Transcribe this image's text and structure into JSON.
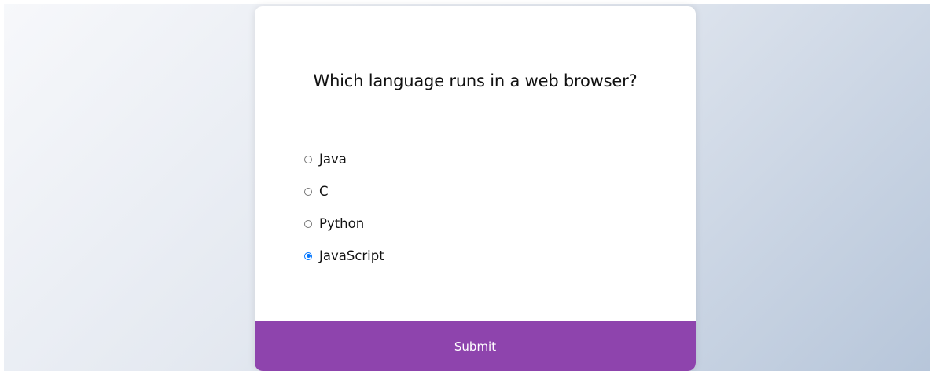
{
  "quiz": {
    "question": "Which language runs in a web browser?",
    "answers": [
      {
        "label": "Java",
        "selected": false
      },
      {
        "label": "C",
        "selected": false
      },
      {
        "label": "Python",
        "selected": false
      },
      {
        "label": "JavaScript",
        "selected": true
      }
    ],
    "submit_label": "Submit"
  },
  "colors": {
    "accent": "#8e44ad",
    "radio_checked": "#0075ff"
  }
}
